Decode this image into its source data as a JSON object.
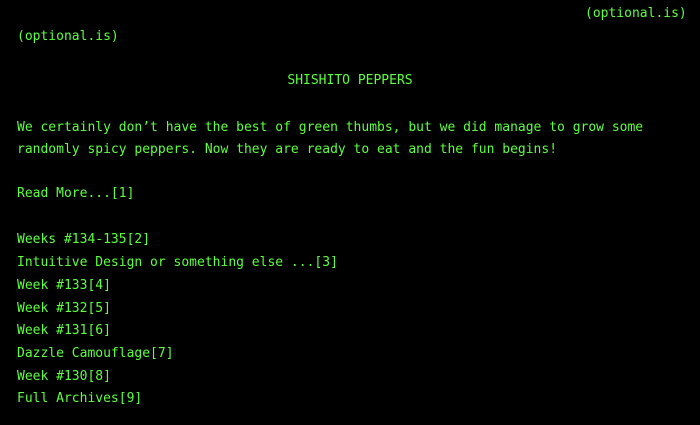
{
  "header": {
    "top_right": "(optional.is)",
    "top_left": "(optional.is)"
  },
  "article": {
    "title": "SHISHITO PEPPERS",
    "paragraph_line1": "We certainly don’t have the best of green thumbs, but we did manage to grow some",
    "paragraph_line2": "randomly spicy peppers. Now they are ready to eat and the fun begins!",
    "read_more": "Read More...[1]"
  },
  "links": [
    "Weeks #134-135[2]",
    "Intuitive Design or something else ...[3]",
    "Week #133[4]",
    "Week #132[5]",
    "Week #131[6]",
    "Dazzle Camouflage[7]",
    "Week #130[8]",
    "Full Archives[9]"
  ],
  "colors": {
    "text": "#5dff3e",
    "background": "#000000"
  }
}
